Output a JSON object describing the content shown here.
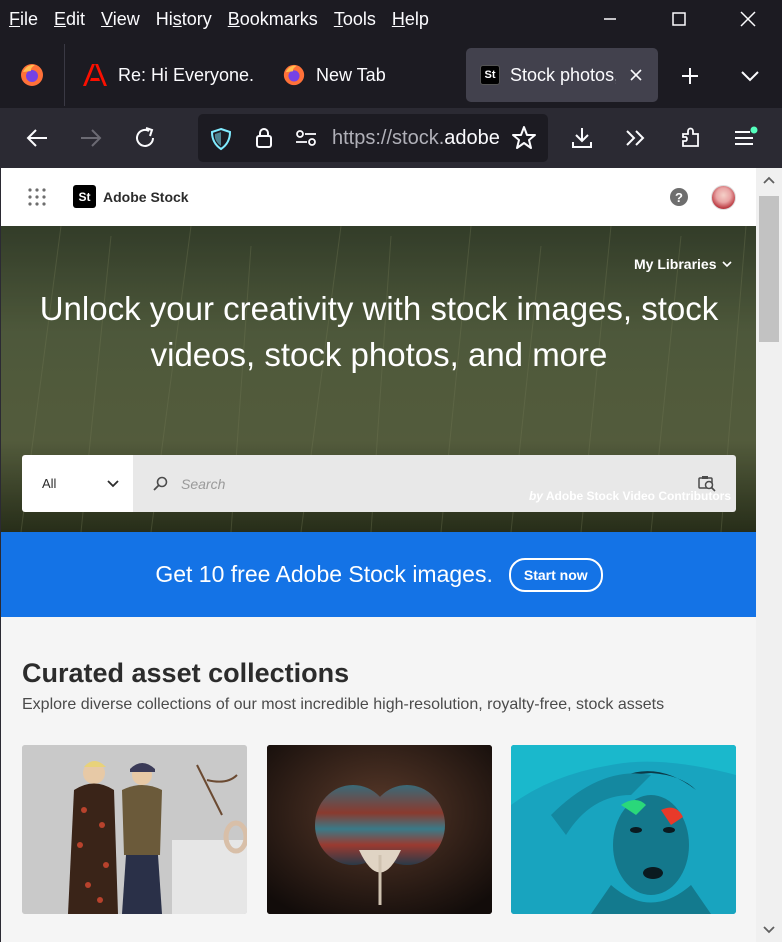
{
  "menubar": {
    "items": [
      {
        "acc": "F",
        "rest": "ile"
      },
      {
        "acc": "E",
        "rest": "dit"
      },
      {
        "acc": "V",
        "rest": "iew"
      },
      {
        "acc": "",
        "pre": "Hi",
        "acc2": "s",
        "post": "tory"
      },
      {
        "acc": "B",
        "rest": "ookmarks"
      },
      {
        "acc": "T",
        "rest": "ools"
      },
      {
        "acc": "H",
        "rest": "elp"
      }
    ]
  },
  "menu": {
    "file_acc": "F",
    "file_rest": "ile",
    "edit_acc": "E",
    "edit_rest": "dit",
    "view_acc": "V",
    "view_rest": "iew",
    "history_pre": "Hi",
    "history_acc": "s",
    "history_rest": "tory",
    "bookmarks_acc": "B",
    "bookmarks_rest": "ookmarks",
    "tools_acc": "T",
    "tools_rest": "ools",
    "help_acc": "H",
    "help_rest": "elp"
  },
  "tabs": {
    "tab1_label": "Re: Hi Everyone. I",
    "tab2_label": "New Tab",
    "tab3_label": "Stock photos, r",
    "tab3_favicon": "St"
  },
  "nav": {
    "url_prefix": "https://stock.",
    "url_domain": "adobe"
  },
  "site": {
    "logo_badge": "St",
    "logo_text": "Adobe Stock",
    "my_libraries": "My Libraries",
    "hero_title": "Unlock your creativity with stock images, stock videos, stock photos, and more",
    "filter_value": "All",
    "search_placeholder": "Search",
    "credit_by": "by",
    "credit_name": "Adobe Stock Video Contributors",
    "banner_text": "Get 10 free Adobe Stock images.",
    "banner_button": "Start now",
    "section_title": "Curated asset collections",
    "section_subtitle": "Explore diverse collections of our most incredible high-resolution, royalty-free, stock assets"
  },
  "colors": {
    "browser_bg": "#1c1b22",
    "toolbar_bg": "#2b2a33",
    "accent_blue": "#1473e6",
    "page_bg": "#f5f5f5"
  }
}
